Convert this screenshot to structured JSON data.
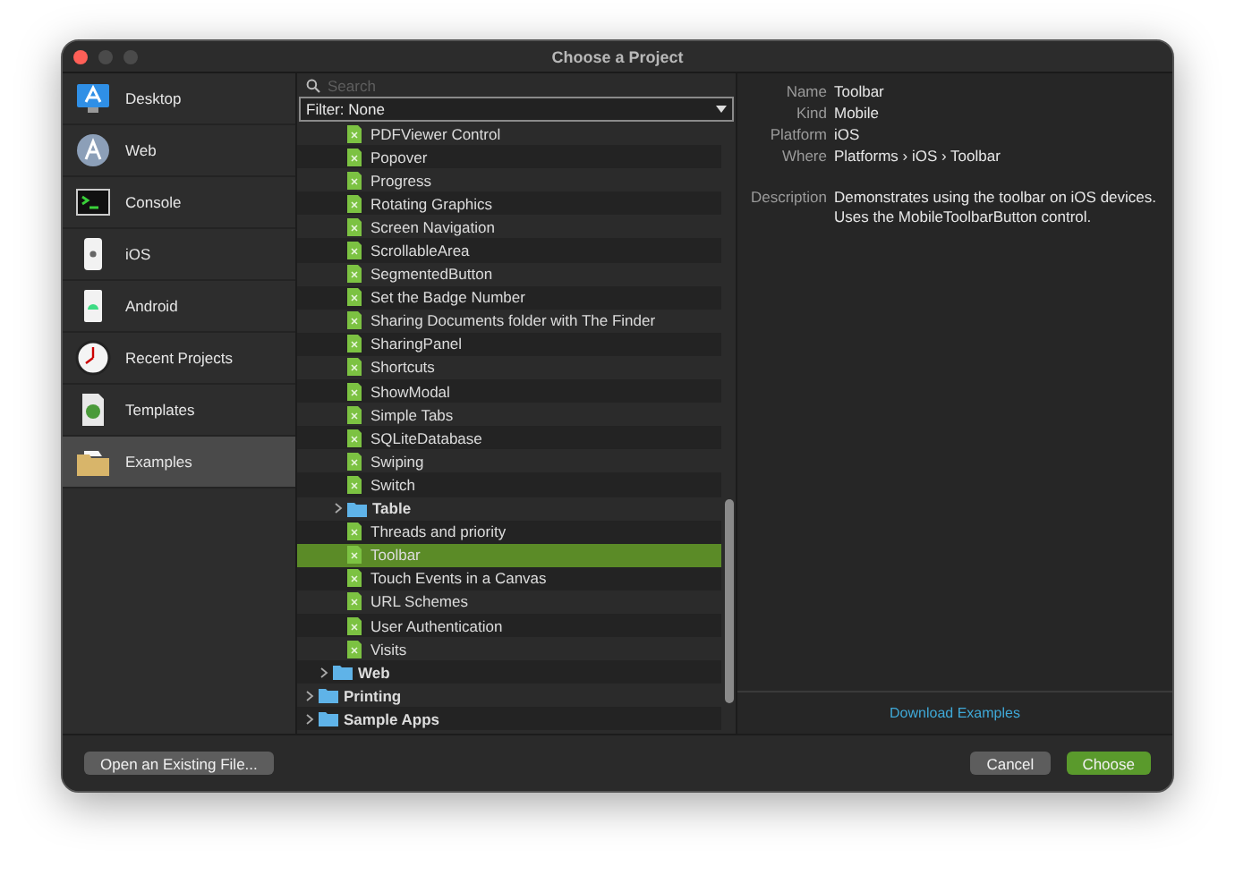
{
  "window": {
    "title": "Choose a Project"
  },
  "sidebar": {
    "items": [
      {
        "label": "Desktop",
        "selected": false
      },
      {
        "label": "Web",
        "selected": false
      },
      {
        "label": "Console",
        "selected": false
      },
      {
        "label": "iOS",
        "selected": false
      },
      {
        "label": "Android",
        "selected": false
      },
      {
        "label": "Recent Projects",
        "selected": false
      },
      {
        "label": "Templates",
        "selected": false
      },
      {
        "label": "Examples",
        "selected": true
      }
    ]
  },
  "search": {
    "placeholder": "Search"
  },
  "filter": {
    "value": "Filter: None"
  },
  "tree": [
    {
      "children": [
        {
          "children": [
            {
              "kind": "file",
              "label": "PDFViewer Control",
              "selected": false
            },
            {
              "kind": "file",
              "label": "Popover",
              "selected": false
            },
            {
              "kind": "file",
              "label": "Progress",
              "selected": false
            },
            {
              "kind": "file",
              "label": "Rotating Graphics",
              "selected": false
            },
            {
              "kind": "file",
              "label": "Screen Navigation",
              "selected": false
            },
            {
              "kind": "file",
              "label": "ScrollableArea",
              "selected": false
            },
            {
              "kind": "file",
              "label": "SegmentedButton",
              "selected": false
            },
            {
              "kind": "file",
              "label": "Set the Badge Number",
              "selected": false
            },
            {
              "kind": "file",
              "label": "Sharing Documents folder with The Finder",
              "selected": false
            },
            {
              "kind": "file",
              "label": "SharingPanel",
              "selected": false
            },
            {
              "kind": "file",
              "label": "Shortcuts",
              "selected": false
            },
            {
              "kind": "file",
              "label": "ShowModal",
              "selected": false
            },
            {
              "kind": "file",
              "label": "Simple Tabs",
              "selected": false
            },
            {
              "kind": "file",
              "label": "SQLiteDatabase",
              "selected": false
            },
            {
              "kind": "file",
              "label": "Swiping",
              "selected": false
            },
            {
              "kind": "file",
              "label": "Switch",
              "selected": false
            },
            {
              "kind": "folder",
              "label": "Table",
              "expanded": false
            },
            {
              "kind": "file",
              "label": "Threads and priority",
              "selected": false
            },
            {
              "kind": "file",
              "label": "Toolbar",
              "selected": true
            },
            {
              "kind": "file",
              "label": "Touch Events in a Canvas",
              "selected": false
            },
            {
              "kind": "file",
              "label": "URL Schemes",
              "selected": false
            },
            {
              "kind": "file",
              "label": "User Authentication",
              "selected": false
            },
            {
              "kind": "file",
              "label": "Visits",
              "selected": false
            }
          ]
        },
        {
          "kind": "folder",
          "label": "Web",
          "expanded": false
        }
      ]
    },
    {
      "kind": "folder",
      "label": "Printing",
      "expanded": false
    },
    {
      "kind": "folder",
      "label": "Sample Apps",
      "expanded": false
    }
  ],
  "details": {
    "fields": [
      {
        "label": "Name",
        "value": "Toolbar"
      },
      {
        "label": "Kind",
        "value": "Mobile"
      },
      {
        "label": "Platform",
        "value": "iOS"
      },
      {
        "label": "Where",
        "value": "Platforms › iOS › Toolbar"
      }
    ],
    "description": {
      "label": "Description",
      "value": "Demonstrates using the toolbar on iOS devices. Uses the MobileToolbarButton control."
    },
    "link": "Download Examples"
  },
  "buttons": {
    "open": "Open an Existing File...",
    "cancel": "Cancel",
    "choose": "Choose"
  }
}
